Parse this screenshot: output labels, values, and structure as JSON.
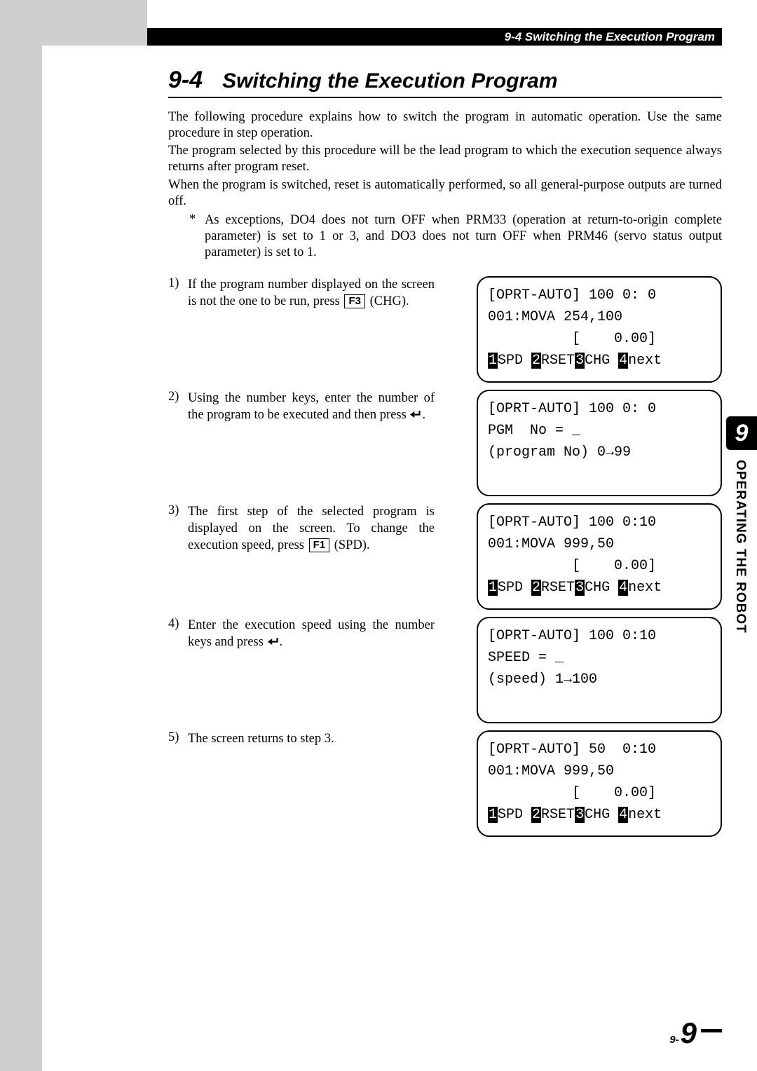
{
  "header": {
    "title": "9-4 Switching the Execution Program"
  },
  "heading": {
    "num": "9-4",
    "title": "Switching the Execution Program"
  },
  "intro": {
    "p1": "The following procedure explains how to switch the program in automatic operation. Use the same procedure in step operation.",
    "p2": "The program selected by this procedure will be the lead program to which the execution sequence always returns after program reset.",
    "p3": "When the program is switched, reset is automatically performed, so all general-purpose outputs are turned off.",
    "note_star": "*",
    "note": "As exceptions, DO4 does not turn OFF when PRM33 (operation at return-to-origin complete parameter) is set to 1 or 3, and DO3 does not turn OFF when PRM46 (servo status output parameter) is set to 1."
  },
  "steps": [
    {
      "num": "1)",
      "text_a": "If the program number displayed on the screen is not the one to be run, press ",
      "key": "F3",
      "text_b": " (CHG).",
      "lcd": {
        "l1": "[OPRT-AUTO] 100 0: 0",
        "l2": "001:MOVA 254,100",
        "l3": "          [    0.00]",
        "fn": [
          "1",
          "SPD ",
          "2",
          "RSET",
          "3",
          "CHG ",
          "4",
          "next"
        ]
      }
    },
    {
      "num": "2)",
      "text_a": "Using the number keys, enter the number of the program to be executed and then press ",
      "enter": true,
      "text_b": ".",
      "lcd": {
        "l1": "[OPRT-AUTO] 100 0: 0",
        "l2": "PGM  No = _",
        "l3": "(program No) 0→99",
        "l4": " "
      }
    },
    {
      "num": "3)",
      "text_a": "The first step of the selected program is displayed on the screen. To change the execution speed, press ",
      "key": "F1",
      "text_b": " (SPD).",
      "lcd": {
        "l1": "[OPRT-AUTO] 100 0:10",
        "l2": "001:MOVA 999,50",
        "l3": "          [    0.00]",
        "fn": [
          "1",
          "SPD ",
          "2",
          "RSET",
          "3",
          "CHG ",
          "4",
          "next"
        ]
      }
    },
    {
      "num": "4)",
      "text_a": "Enter the execution speed using the number keys and press ",
      "enter": true,
      "text_b": ".",
      "lcd": {
        "l1": "[OPRT-AUTO] 100 0:10",
        "l2": "SPEED = _",
        "l3": "(speed) 1→100",
        "l4": " "
      }
    },
    {
      "num": "5)",
      "text_a": "The screen returns to step 3.",
      "lcd": {
        "l1": "[OPRT-AUTO] 50  0:10",
        "l2": "001:MOVA 999,50",
        "l3": "          [    0.00]",
        "fn": [
          "1",
          "SPD ",
          "2",
          "RSET",
          "3",
          "CHG ",
          "4",
          "next"
        ]
      }
    }
  ],
  "side": {
    "chapter_num": "9",
    "chapter_label": "OPERATING THE ROBOT"
  },
  "pagenum": {
    "prefix": "9-",
    "num": "9"
  }
}
